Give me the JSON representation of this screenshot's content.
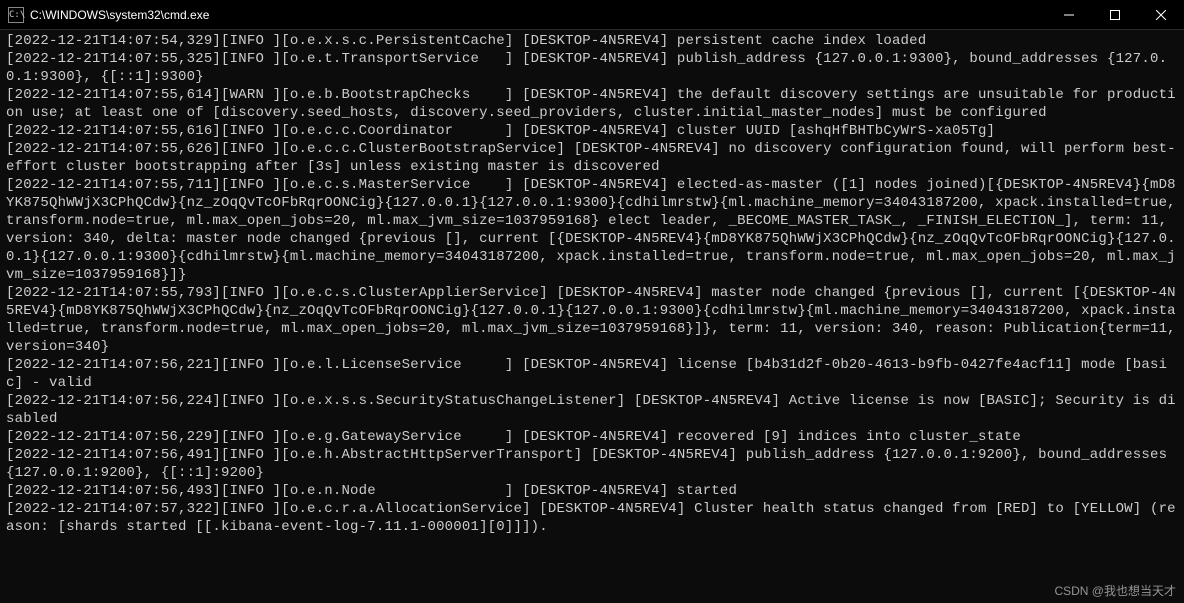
{
  "window": {
    "title": "C:\\WINDOWS\\system32\\cmd.exe",
    "icon_glyph": "C:\\"
  },
  "logs": [
    "[2022-12-21T14:07:54,329][INFO ][o.e.x.s.c.PersistentCache] [DESKTOP-4N5REV4] persistent cache index loaded",
    "[2022-12-21T14:07:55,325][INFO ][o.e.t.TransportService   ] [DESKTOP-4N5REV4] publish_address {127.0.0.1:9300}, bound_addresses {127.0.0.1:9300}, {[::1]:9300}",
    "[2022-12-21T14:07:55,614][WARN ][o.e.b.BootstrapChecks    ] [DESKTOP-4N5REV4] the default discovery settings are unsuitable for production use; at least one of [discovery.seed_hosts, discovery.seed_providers, cluster.initial_master_nodes] must be configured",
    "[2022-12-21T14:07:55,616][INFO ][o.e.c.c.Coordinator      ] [DESKTOP-4N5REV4] cluster UUID [ashqHfBHTbCyWrS-xa05Tg]",
    "[2022-12-21T14:07:55,626][INFO ][o.e.c.c.ClusterBootstrapService] [DESKTOP-4N5REV4] no discovery configuration found, will perform best-effort cluster bootstrapping after [3s] unless existing master is discovered",
    "[2022-12-21T14:07:55,711][INFO ][o.e.c.s.MasterService    ] [DESKTOP-4N5REV4] elected-as-master ([1] nodes joined)[{DESKTOP-4N5REV4}{mD8YK875QhWWjX3CPhQCdw}{nz_zOqQvTcOFbRqrOONCig}{127.0.0.1}{127.0.0.1:9300}{cdhilmrstw}{ml.machine_memory=34043187200, xpack.installed=true, transform.node=true, ml.max_open_jobs=20, ml.max_jvm_size=1037959168} elect leader, _BECOME_MASTER_TASK_, _FINISH_ELECTION_], term: 11, version: 340, delta: master node changed {previous [], current [{DESKTOP-4N5REV4}{mD8YK875QhWWjX3CPhQCdw}{nz_zOqQvTcOFbRqrOONCig}{127.0.0.1}{127.0.0.1:9300}{cdhilmrstw}{ml.machine_memory=34043187200, xpack.installed=true, transform.node=true, ml.max_open_jobs=20, ml.max_jvm_size=1037959168}]}",
    "[2022-12-21T14:07:55,793][INFO ][o.e.c.s.ClusterApplierService] [DESKTOP-4N5REV4] master node changed {previous [], current [{DESKTOP-4N5REV4}{mD8YK875QhWWjX3CPhQCdw}{nz_zOqQvTcOFbRqrOONCig}{127.0.0.1}{127.0.0.1:9300}{cdhilmrstw}{ml.machine_memory=34043187200, xpack.installed=true, transform.node=true, ml.max_open_jobs=20, ml.max_jvm_size=1037959168}]}, term: 11, version: 340, reason: Publication{term=11, version=340}",
    "[2022-12-21T14:07:56,221][INFO ][o.e.l.LicenseService     ] [DESKTOP-4N5REV4] license [b4b31d2f-0b20-4613-b9fb-0427fe4acf11] mode [basic] - valid",
    "[2022-12-21T14:07:56,224][INFO ][o.e.x.s.s.SecurityStatusChangeListener] [DESKTOP-4N5REV4] Active license is now [BASIC]; Security is disabled",
    "[2022-12-21T14:07:56,229][INFO ][o.e.g.GatewayService     ] [DESKTOP-4N5REV4] recovered [9] indices into cluster_state",
    "[2022-12-21T14:07:56,491][INFO ][o.e.h.AbstractHttpServerTransport] [DESKTOP-4N5REV4] publish_address {127.0.0.1:9200}, bound_addresses {127.0.0.1:9200}, {[::1]:9200}",
    "[2022-12-21T14:07:56,493][INFO ][o.e.n.Node               ] [DESKTOP-4N5REV4] started",
    "[2022-12-21T14:07:57,322][INFO ][o.e.c.r.a.AllocationService] [DESKTOP-4N5REV4] Cluster health status changed from [RED] to [YELLOW] (reason: [shards started [[.kibana-event-log-7.11.1-000001][0]]])."
  ],
  "watermark": "CSDN @我也想当天才"
}
